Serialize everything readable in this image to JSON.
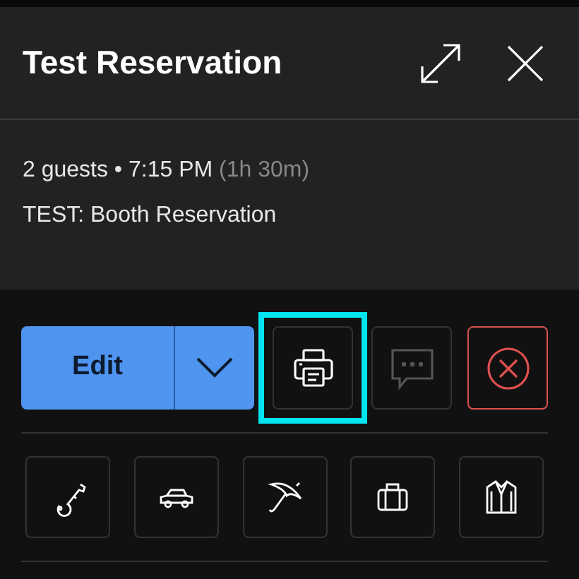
{
  "header": {
    "title": "Test Reservation"
  },
  "details": {
    "guests": "2 guests",
    "separator": "•",
    "time": "7:15 PM",
    "duration": "(1h 30m)",
    "note": "TEST: Booth Reservation"
  },
  "actions": [
    {
      "kind": "edit",
      "label": "Edit"
    },
    {
      "kind": "print",
      "highlighted": true
    },
    {
      "kind": "message",
      "disabled": true
    },
    {
      "kind": "cancel"
    }
  ],
  "services": [
    {
      "kind": "key"
    },
    {
      "kind": "car"
    },
    {
      "kind": "umbrella"
    },
    {
      "kind": "luggage"
    },
    {
      "kind": "coat"
    }
  ]
}
